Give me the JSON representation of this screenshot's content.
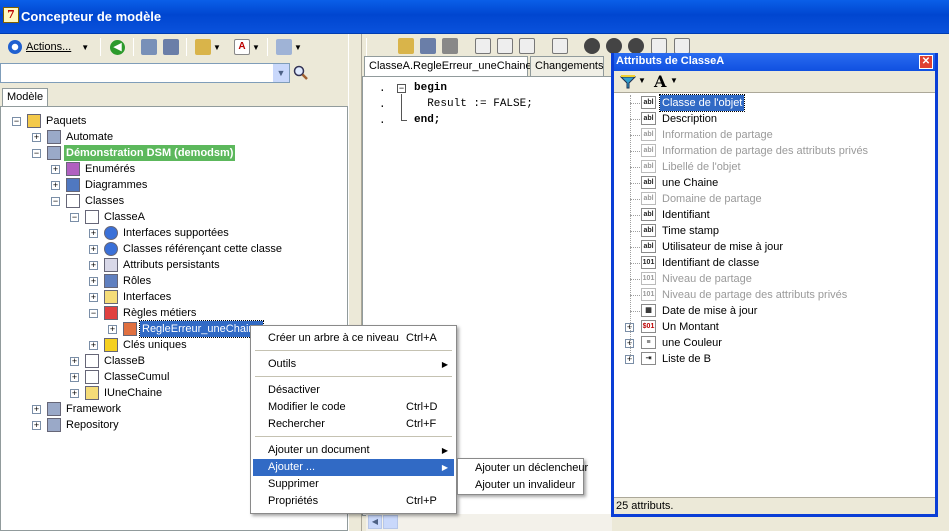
{
  "window": {
    "title": "Concepteur de modèle"
  },
  "left_toolbar": {
    "actions_label": "Actions..."
  },
  "model_tab": {
    "label": "Modèle"
  },
  "tree": [
    {
      "id": "paquets",
      "label": "Paquets",
      "icon": "folder-icon"
    },
    {
      "id": "automate",
      "label": "Automate",
      "icon": "package-icon"
    },
    {
      "id": "demo",
      "label": "Démonstration DSM (demodsm)",
      "icon": "package-icon",
      "highlight": "#5cb85c"
    },
    {
      "id": "enumeres",
      "label": "Enumérés",
      "icon": "enum-icon"
    },
    {
      "id": "diagrammes",
      "label": "Diagrammes",
      "icon": "diagram-icon"
    },
    {
      "id": "classes",
      "label": "Classes",
      "icon": "class-folder-icon"
    },
    {
      "id": "classeA",
      "label": "ClasseA",
      "icon": "class-icon"
    },
    {
      "id": "interfaces_supportees",
      "label": "Interfaces supportées",
      "icon": "help-icon"
    },
    {
      "id": "classes_referencant",
      "label": "Classes référençant cette classe",
      "icon": "help-icon"
    },
    {
      "id": "attributs_persistants",
      "label": "Attributs persistants",
      "icon": "attribute-icon"
    },
    {
      "id": "roles",
      "label": "Rôles",
      "icon": "role-icon"
    },
    {
      "id": "interfaces",
      "label": "Interfaces",
      "icon": "interface-icon"
    },
    {
      "id": "regles",
      "label": "Règles métiers",
      "icon": "rule-icon"
    },
    {
      "id": "regle_erreur",
      "label": "RegleErreur_uneChaine",
      "icon": "rule-error-icon",
      "selected": true
    },
    {
      "id": "cles",
      "label": "Clés uniques",
      "icon": "warning-icon"
    },
    {
      "id": "classeB",
      "label": "ClasseB",
      "icon": "class-icon"
    },
    {
      "id": "classeCumul",
      "label": "ClasseCumul",
      "icon": "class-icon"
    },
    {
      "id": "iunechaine",
      "label": "IUneChaine",
      "icon": "interface-icon"
    },
    {
      "id": "framework",
      "label": "Framework",
      "icon": "package-icon"
    },
    {
      "id": "repository",
      "label": "Repository",
      "icon": "package-icon"
    }
  ],
  "editor": {
    "tabs": [
      {
        "label": "ClasseA.RegleErreur_uneChaine",
        "active": true
      },
      {
        "label": "Changements",
        "active": false
      }
    ],
    "lines": [
      "begin",
      "  Result := FALSE;",
      "end;"
    ],
    "gutter": [
      ".",
      ".",
      "."
    ]
  },
  "attributes_window": {
    "title": "Attributs de ClasseA",
    "close_label": "✕",
    "items": [
      {
        "label": "Classe de l'objet",
        "type": "abl",
        "enabled": true,
        "selected": true
      },
      {
        "label": "Description",
        "type": "abl",
        "enabled": true
      },
      {
        "label": "Information de partage",
        "type": "abl",
        "enabled": false
      },
      {
        "label": "Information de partage des attributs privés",
        "type": "abl",
        "enabled": false
      },
      {
        "label": "Libellé de l'objet",
        "type": "abl",
        "enabled": false
      },
      {
        "label": "une Chaine",
        "type": "abl",
        "enabled": true
      },
      {
        "label": "Domaine de partage",
        "type": "abl",
        "enabled": false
      },
      {
        "label": "Identifiant",
        "type": "abl",
        "enabled": true
      },
      {
        "label": "Time stamp",
        "type": "abl",
        "enabled": true
      },
      {
        "label": "Utilisateur de mise à jour",
        "type": "abl",
        "enabled": true
      },
      {
        "label": "Identifiant de classe",
        "type": "101",
        "enabled": true
      },
      {
        "label": "Niveau de partage",
        "type": "101",
        "enabled": false
      },
      {
        "label": "Niveau de partage des attributs privés",
        "type": "101",
        "enabled": false
      },
      {
        "label": "Date de mise à jour",
        "type": "date",
        "enabled": true
      },
      {
        "label": "Un Montant",
        "type": "money",
        "enabled": true,
        "expandable": true
      },
      {
        "label": "une Couleur",
        "type": "enum",
        "enabled": true,
        "expandable": true
      },
      {
        "label": "Liste de B",
        "type": "list",
        "enabled": true,
        "expandable": true
      }
    ],
    "status": "25 attributs."
  },
  "context_menu": {
    "items": [
      {
        "label": "Créer un arbre à ce niveau",
        "shortcut": "Ctrl+A"
      },
      {
        "separator": true
      },
      {
        "label": "Outils",
        "submenu": true
      },
      {
        "separator": true
      },
      {
        "label": "Désactiver"
      },
      {
        "label": "Modifier le code",
        "shortcut": "Ctrl+D"
      },
      {
        "label": "Rechercher",
        "shortcut": "Ctrl+F"
      },
      {
        "separator": true
      },
      {
        "label": "Ajouter un document",
        "submenu": true
      },
      {
        "label": "Ajouter ...",
        "submenu": true,
        "highlighted": true
      },
      {
        "label": "Supprimer"
      },
      {
        "label": "Propriétés",
        "shortcut": "Ctrl+P"
      }
    ]
  },
  "submenu": {
    "items": [
      {
        "label": "Ajouter un déclencheur"
      },
      {
        "label": "Ajouter un invalideur"
      }
    ]
  },
  "colors": {
    "accent": "#316ac5",
    "title_bar": "#0a5fe8",
    "highlight_node": "#5cb85c"
  }
}
